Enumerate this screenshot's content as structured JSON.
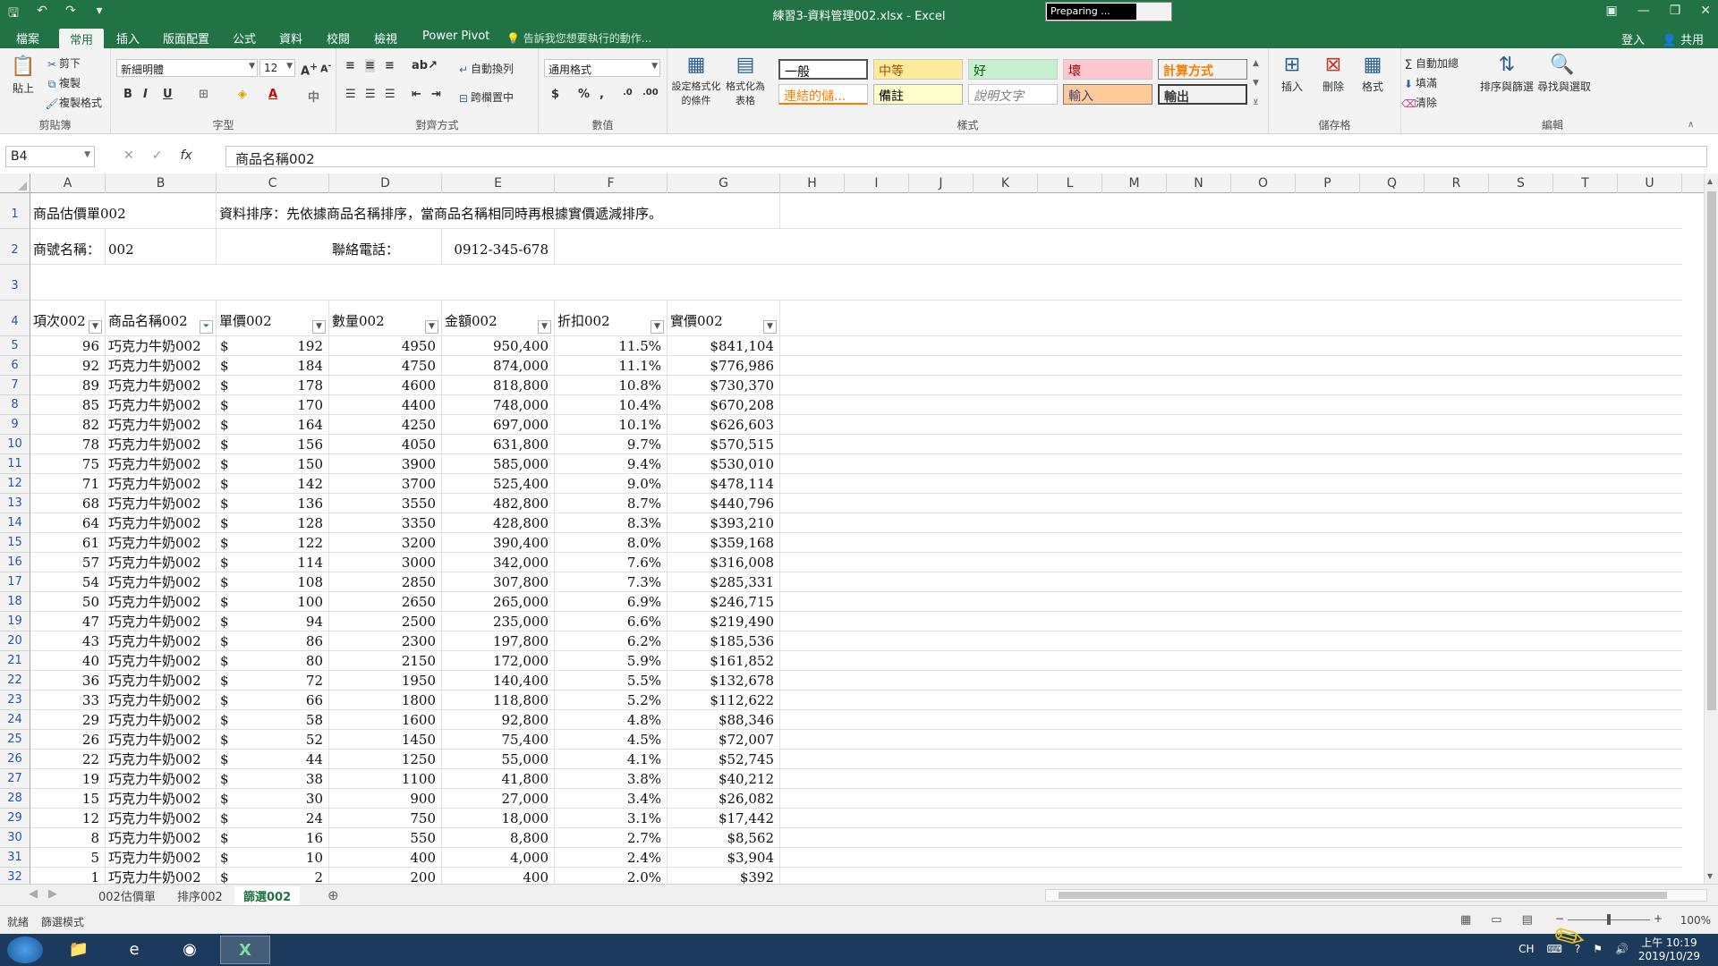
{
  "window": {
    "title": "練習3-資料管理002.xlsx - Excel",
    "preparing": "Preparing ..."
  },
  "tabs": [
    "檔案",
    "常用",
    "插入",
    "版面配置",
    "公式",
    "資料",
    "校閱",
    "檢視",
    "Power Pivot"
  ],
  "tell_me": "告訴我您想要執行的動作...",
  "signin": "登入",
  "share": "共用",
  "ribbon": {
    "clipboard": {
      "label": "剪貼簿",
      "paste": "貼上",
      "cut": "剪下",
      "copy": "複製",
      "format_painter": "複製格式"
    },
    "font": {
      "label": "字型",
      "name": "新細明體",
      "size": "12"
    },
    "alignment": {
      "label": "對齊方式",
      "wrap": "自動換列",
      "merge": "跨欄置中"
    },
    "number": {
      "label": "數值",
      "format": "通用格式"
    },
    "styles": {
      "label": "樣式",
      "conditional": "設定格式化的條件",
      "as_table": "格式化為表格",
      "cells": [
        "一般",
        "中等",
        "好",
        "壞",
        "計算方式",
        "連結的儲...",
        "備註",
        "說明文字",
        "輸入",
        "輸出"
      ]
    },
    "cells_group": {
      "label": "儲存格",
      "insert": "插入",
      "delete": "刪除",
      "format": "格式"
    },
    "editing": {
      "label": "編輯",
      "autosum": "自動加總",
      "fill": "填滿",
      "clear": "清除",
      "sort_filter": "排序與篩選",
      "find_select": "尋找與選取"
    }
  },
  "formula_bar": {
    "name_box": "B4",
    "fx": "fx",
    "content": "商品名稱002"
  },
  "columns": [
    "A",
    "B",
    "C",
    "D",
    "E",
    "F",
    "G",
    "H",
    "I",
    "J",
    "K",
    "L",
    "M",
    "N",
    "O",
    "P",
    "Q",
    "R",
    "S",
    "T",
    "U"
  ],
  "sheet": {
    "r1": {
      "title": "商品估價單002",
      "note": "資料排序：先依據商品名稱排序，當商品名稱相同時再根據實價遞減排序。"
    },
    "r2": {
      "shop_label": "商號名稱：",
      "shop_value": "002",
      "phone_label": "聯絡電話：",
      "phone_value": "0912-345-678"
    },
    "headers": [
      "項次002",
      "商品名稱002",
      "單價002",
      "數量002",
      "金額002",
      "折扣002",
      "實價002"
    ],
    "rows": [
      [
        "96",
        "巧克力牛奶002",
        "$",
        "192",
        "4950",
        "950,400",
        "11.5%",
        "$841,104"
      ],
      [
        "92",
        "巧克力牛奶002",
        "$",
        "184",
        "4750",
        "874,000",
        "11.1%",
        "$776,986"
      ],
      [
        "89",
        "巧克力牛奶002",
        "$",
        "178",
        "4600",
        "818,800",
        "10.8%",
        "$730,370"
      ],
      [
        "85",
        "巧克力牛奶002",
        "$",
        "170",
        "4400",
        "748,000",
        "10.4%",
        "$670,208"
      ],
      [
        "82",
        "巧克力牛奶002",
        "$",
        "164",
        "4250",
        "697,000",
        "10.1%",
        "$626,603"
      ],
      [
        "78",
        "巧克力牛奶002",
        "$",
        "156",
        "4050",
        "631,800",
        "9.7%",
        "$570,515"
      ],
      [
        "75",
        "巧克力牛奶002",
        "$",
        "150",
        "3900",
        "585,000",
        "9.4%",
        "$530,010"
      ],
      [
        "71",
        "巧克力牛奶002",
        "$",
        "142",
        "3700",
        "525,400",
        "9.0%",
        "$478,114"
      ],
      [
        "68",
        "巧克力牛奶002",
        "$",
        "136",
        "3550",
        "482,800",
        "8.7%",
        "$440,796"
      ],
      [
        "64",
        "巧克力牛奶002",
        "$",
        "128",
        "3350",
        "428,800",
        "8.3%",
        "$393,210"
      ],
      [
        "61",
        "巧克力牛奶002",
        "$",
        "122",
        "3200",
        "390,400",
        "8.0%",
        "$359,168"
      ],
      [
        "57",
        "巧克力牛奶002",
        "$",
        "114",
        "3000",
        "342,000",
        "7.6%",
        "$316,008"
      ],
      [
        "54",
        "巧克力牛奶002",
        "$",
        "108",
        "2850",
        "307,800",
        "7.3%",
        "$285,331"
      ],
      [
        "50",
        "巧克力牛奶002",
        "$",
        "100",
        "2650",
        "265,000",
        "6.9%",
        "$246,715"
      ],
      [
        "47",
        "巧克力牛奶002",
        "$",
        "94",
        "2500",
        "235,000",
        "6.6%",
        "$219,490"
      ],
      [
        "43",
        "巧克力牛奶002",
        "$",
        "86",
        "2300",
        "197,800",
        "6.2%",
        "$185,536"
      ],
      [
        "40",
        "巧克力牛奶002",
        "$",
        "80",
        "2150",
        "172,000",
        "5.9%",
        "$161,852"
      ],
      [
        "36",
        "巧克力牛奶002",
        "$",
        "72",
        "1950",
        "140,400",
        "5.5%",
        "$132,678"
      ],
      [
        "33",
        "巧克力牛奶002",
        "$",
        "66",
        "1800",
        "118,800",
        "5.2%",
        "$112,622"
      ],
      [
        "29",
        "巧克力牛奶002",
        "$",
        "58",
        "1600",
        "92,800",
        "4.8%",
        "$88,346"
      ],
      [
        "26",
        "巧克力牛奶002",
        "$",
        "52",
        "1450",
        "75,400",
        "4.5%",
        "$72,007"
      ],
      [
        "22",
        "巧克力牛奶002",
        "$",
        "44",
        "1250",
        "55,000",
        "4.1%",
        "$52,745"
      ],
      [
        "19",
        "巧克力牛奶002",
        "$",
        "38",
        "1100",
        "41,800",
        "3.8%",
        "$40,212"
      ],
      [
        "15",
        "巧克力牛奶002",
        "$",
        "30",
        "900",
        "27,000",
        "3.4%",
        "$26,082"
      ],
      [
        "12",
        "巧克力牛奶002",
        "$",
        "24",
        "750",
        "18,000",
        "3.1%",
        "$17,442"
      ],
      [
        "8",
        "巧克力牛奶002",
        "$",
        "16",
        "550",
        "8,800",
        "2.7%",
        "$8,562"
      ],
      [
        "5",
        "巧克力牛奶002",
        "$",
        "10",
        "400",
        "4,000",
        "2.4%",
        "$3,904"
      ],
      [
        "1",
        "巧克力牛奶002",
        "$",
        "2",
        "200",
        "400",
        "2.0%",
        "$392"
      ]
    ],
    "row_numbers": [
      "1",
      "2",
      "3",
      "4",
      "5",
      "6",
      "7",
      "8",
      "9",
      "10",
      "11",
      "12",
      "13",
      "14",
      "15",
      "16",
      "17",
      "18",
      "19",
      "20",
      "21",
      "22",
      "23",
      "24",
      "25",
      "26",
      "27",
      "28",
      "29",
      "30",
      "31",
      "32"
    ]
  },
  "sheet_tabs": [
    "002估價單",
    "排序002",
    "篩選002"
  ],
  "status": {
    "ready": "就緒",
    "mode": "篩選模式",
    "zoom": "100%"
  },
  "taskbar": {
    "lang": "CH",
    "time": "上午 10:19",
    "date": "2019/10/29"
  },
  "colors": {
    "accent": "#217346",
    "header_bg": "#f3f3f3"
  }
}
